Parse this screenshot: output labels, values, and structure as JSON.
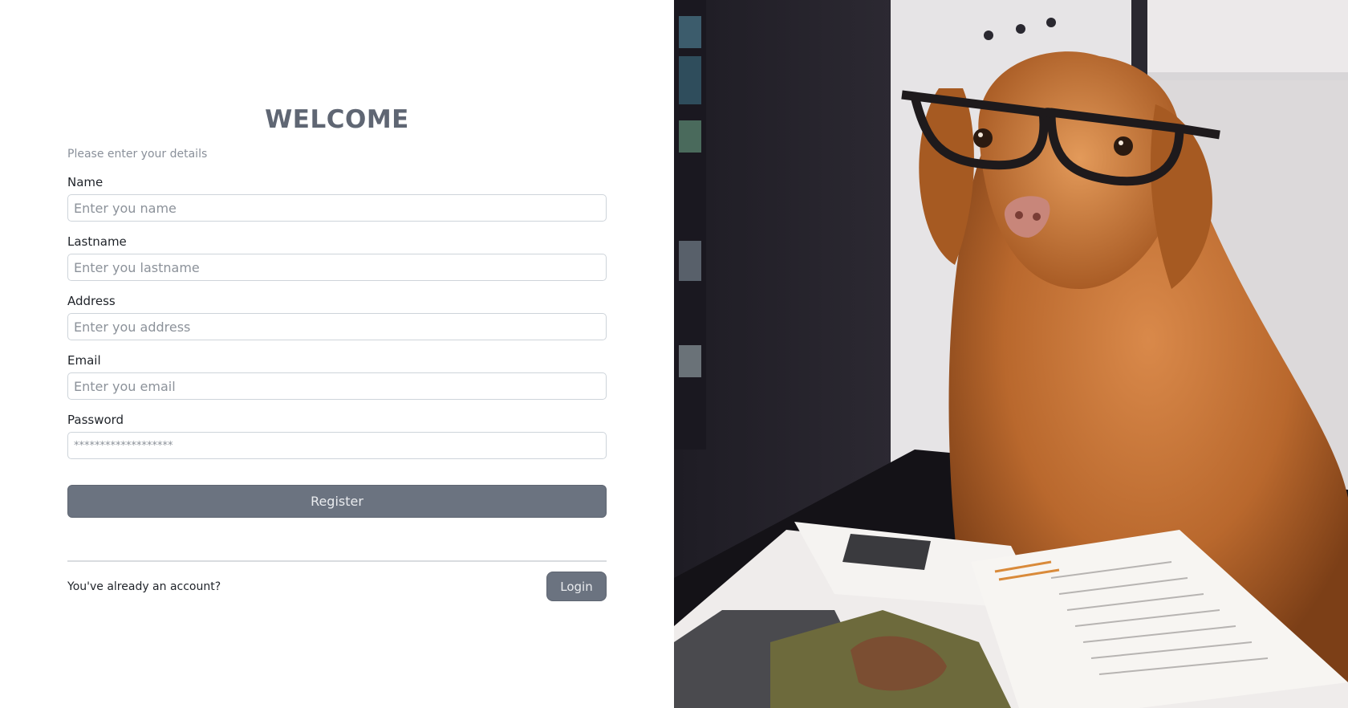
{
  "form": {
    "title": "WELCOME",
    "subtitle": "Please enter your details",
    "fields": [
      {
        "label": "Name",
        "placeholder": "Enter you name"
      },
      {
        "label": "Lastname",
        "placeholder": "Enter you lastname"
      },
      {
        "label": "Address",
        "placeholder": "Enter you address"
      },
      {
        "label": "Email",
        "placeholder": "Enter you email"
      },
      {
        "label": "Password",
        "placeholder": "*******************"
      }
    ],
    "register_label": "Register"
  },
  "footer": {
    "account_text": "You've already an account?",
    "login_label": "Login"
  },
  "hero_image": {
    "description_icon": "dog-with-glasses-photo"
  },
  "colors": {
    "button_bg": "#6b7380",
    "title_color": "#5f6673",
    "muted_text": "#8a909a"
  }
}
